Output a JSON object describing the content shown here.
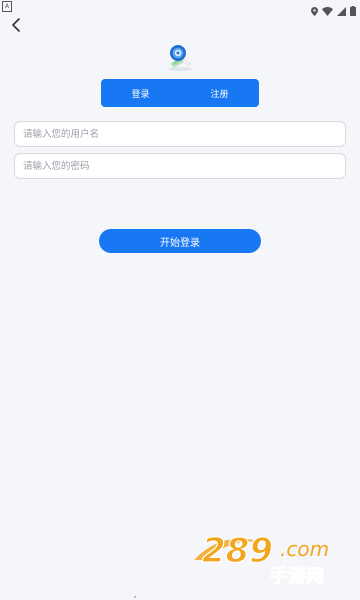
{
  "status_bar": {
    "notification_icon": "a-icon",
    "icons": [
      "location-icon",
      "wifi-icon",
      "signal-icon",
      "battery-icon"
    ]
  },
  "nav": {
    "back_icon": "chevron-left-icon"
  },
  "tabs": [
    {
      "label": "登录",
      "active": true
    },
    {
      "label": "注册",
      "active": false
    }
  ],
  "form": {
    "username_placeholder": "请输入您的用户名",
    "username_value": "",
    "password_placeholder": "请输入您的密码",
    "password_value": ""
  },
  "login_button": {
    "label": "开始登录"
  },
  "watermark": {
    "text_top": "289.com",
    "text_bottom": "手游网"
  },
  "colors": {
    "primary": "#1877f2",
    "background": "#f5f6fa",
    "border": "#d8dbe2",
    "watermark": "#f2a51d"
  }
}
